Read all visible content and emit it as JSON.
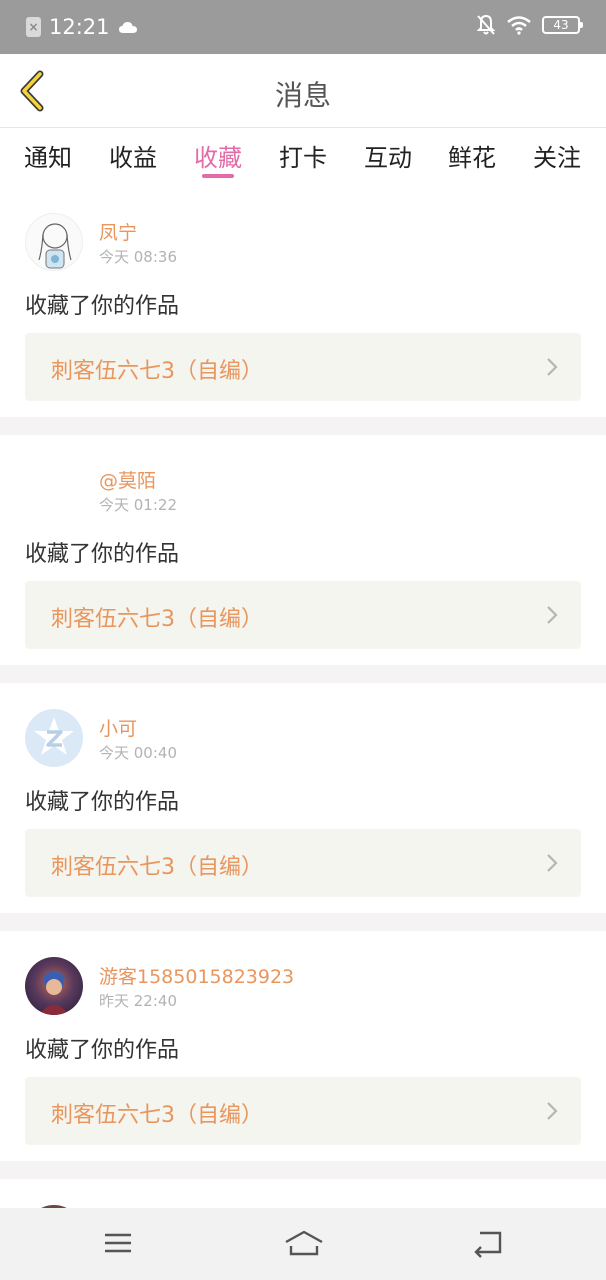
{
  "status_bar": {
    "time": "12:21",
    "battery": "43"
  },
  "header": {
    "title": "消息",
    "back_icon": "back-chevron-icon"
  },
  "tabs": [
    {
      "label": "通知",
      "active": false
    },
    {
      "label": "收益",
      "active": false
    },
    {
      "label": "收藏",
      "active": true
    },
    {
      "label": "打卡",
      "active": false
    },
    {
      "label": "互动",
      "active": false
    },
    {
      "label": "鲜花",
      "active": false
    },
    {
      "label": "关注",
      "active": false
    }
  ],
  "messages": [
    {
      "username": "凤宁",
      "time": "今天 08:36",
      "action": "收藏了你的作品",
      "work_title": "刺客伍六七3（自编）"
    },
    {
      "username": "@莫陌",
      "time": "今天 01:22",
      "action": "收藏了你的作品",
      "work_title": "刺客伍六七3（自编）"
    },
    {
      "username": "小可",
      "time": "今天 00:40",
      "action": "收藏了你的作品",
      "work_title": "刺客伍六七3（自编）"
    },
    {
      "username": "游客1585015823923",
      "time": "昨天 22:40",
      "action": "收藏了你的作品",
      "work_title": "刺客伍六七3（自编）"
    }
  ],
  "colors": {
    "accent": "#e36ba7",
    "username": "#e8965e",
    "status_bar": "#9b9b9b"
  },
  "nav": {
    "menu_icon": "menu-icon",
    "home_icon": "home-icon",
    "back_icon": "back-icon"
  }
}
